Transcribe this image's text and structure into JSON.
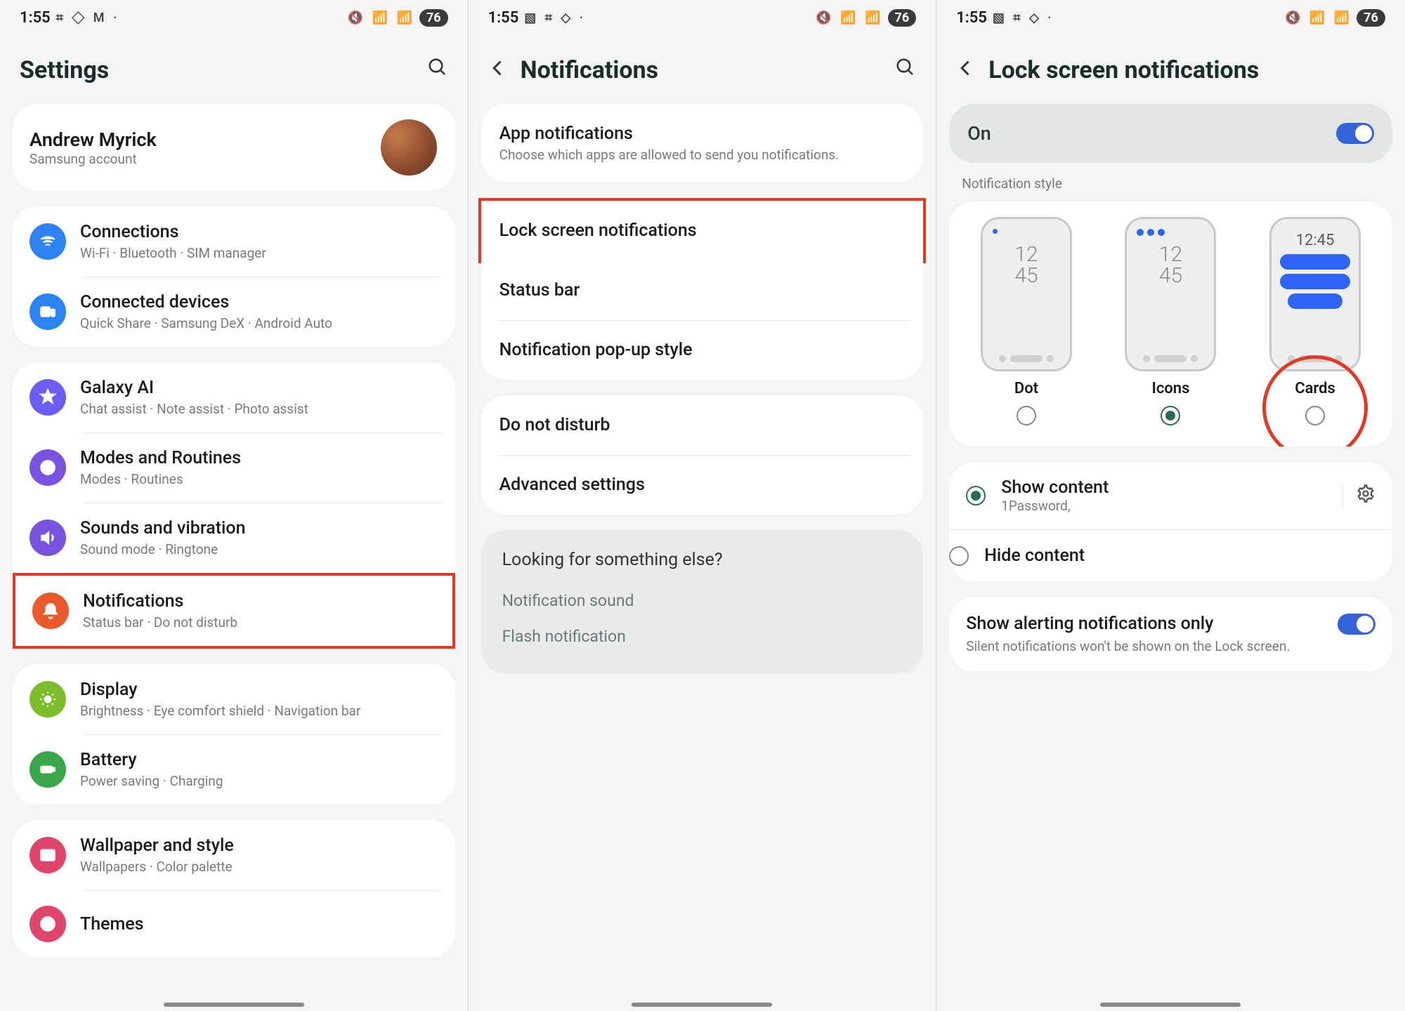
{
  "status": {
    "time": "1:55",
    "left_icons_a": "⌗ ◇ M ·",
    "left_icons_b": "▧ ⌗ ◇ ·",
    "right_icons": "🔇 📶 📶",
    "battery": "76"
  },
  "screen1": {
    "title": "Settings",
    "account": {
      "name": "Andrew Myrick",
      "sub": "Samsung account"
    },
    "g1": [
      {
        "title": "Connections",
        "sub": "Wi-Fi · Bluetooth · SIM manager",
        "color": "#2d82f5",
        "icon": "wifi"
      },
      {
        "title": "Connected devices",
        "sub": "Quick Share · Samsung DeX · Android Auto",
        "color": "#2d82f5",
        "icon": "devices"
      }
    ],
    "g2": [
      {
        "title": "Galaxy AI",
        "sub": "Chat assist · Note assist · Photo assist",
        "color": "#6a5cf5",
        "icon": "star"
      },
      {
        "title": "Modes and Routines",
        "sub": "Modes · Routines",
        "color": "#7a52e0",
        "icon": "clock"
      },
      {
        "title": "Sounds and vibration",
        "sub": "Sound mode · Ringtone",
        "color": "#7a52e0",
        "icon": "sound"
      },
      {
        "title": "Notifications",
        "sub": "Status bar · Do not disturb",
        "color": "#e85a2a",
        "icon": "bell",
        "highlight": true
      }
    ],
    "g3": [
      {
        "title": "Display",
        "sub": "Brightness · Eye comfort shield · Navigation bar",
        "color": "#7bbd2a",
        "icon": "sun"
      },
      {
        "title": "Battery",
        "sub": "Power saving · Charging",
        "color": "#3aa84a",
        "icon": "battery"
      }
    ],
    "g4": [
      {
        "title": "Wallpaper and style",
        "sub": "Wallpapers · Color palette",
        "color": "#e0456b",
        "icon": "image"
      },
      {
        "title": "Themes",
        "sub": "",
        "color": "#e0456b",
        "icon": "palette"
      }
    ]
  },
  "screen2": {
    "title": "Notifications",
    "g1": [
      {
        "title": "App notifications",
        "sub": "Choose which apps are allowed to send you notifications."
      }
    ],
    "g2": [
      {
        "title": "Lock screen notifications",
        "highlight": true
      },
      {
        "title": "Status bar"
      },
      {
        "title": "Notification pop-up style"
      }
    ],
    "g3": [
      {
        "title": "Do not disturb"
      },
      {
        "title": "Advanced settings"
      }
    ],
    "looking": {
      "title": "Looking for something else?",
      "items": [
        "Notification sound",
        "Flash notification"
      ]
    }
  },
  "screen3": {
    "title": "Lock screen notifications",
    "on_label": "On",
    "style_label": "Notification style",
    "styles": [
      {
        "label": "Dot",
        "selected": false,
        "type": "dot"
      },
      {
        "label": "Icons",
        "selected": true,
        "type": "icons"
      },
      {
        "label": "Cards",
        "selected": false,
        "type": "cards",
        "circled": true
      }
    ],
    "preview_time": "12\n45",
    "preview_card_time": "12:45",
    "content": [
      {
        "title": "Show content",
        "sub": "1Password,",
        "selected": true,
        "gear": true
      },
      {
        "title": "Hide content",
        "selected": false
      }
    ],
    "alerting": {
      "title": "Show alerting notifications only",
      "sub": "Silent notifications won't be shown on the Lock screen."
    }
  }
}
